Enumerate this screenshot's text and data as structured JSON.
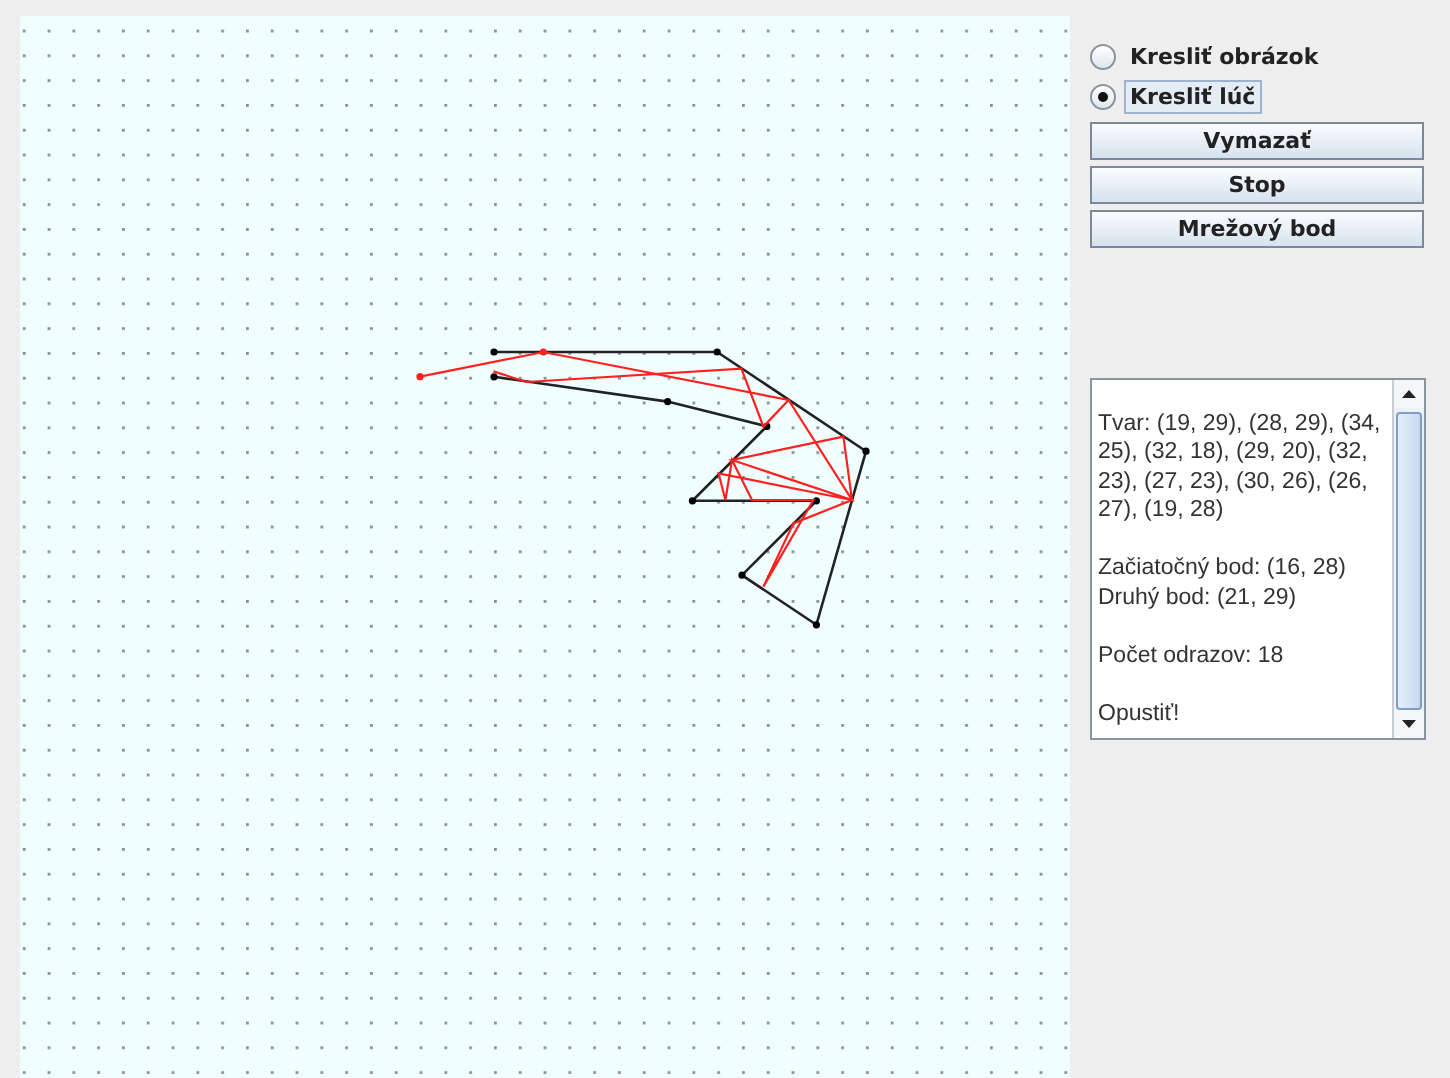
{
  "modes": [
    {
      "label": "Kresliť obrázok",
      "selected": false
    },
    {
      "label": "Kresliť lúč",
      "selected": true
    }
  ],
  "buttons": [
    "Vymazať",
    "Stop",
    "Mrežový bod"
  ],
  "output": {
    "paragraphs": [
      [
        "Tvar: (19, 29), (28, 29), (34, 25), (32, 18), (29, 20), (32, 23), (27, 23), (30, 26), (26, 27), (19, 28)"
      ],
      [
        "Začiatočný bod: (16, 28)",
        "Druhý bod: (21, 29)"
      ],
      [
        "Počet odrazov: 18"
      ],
      [
        "Opustiť!"
      ]
    ]
  }
}
